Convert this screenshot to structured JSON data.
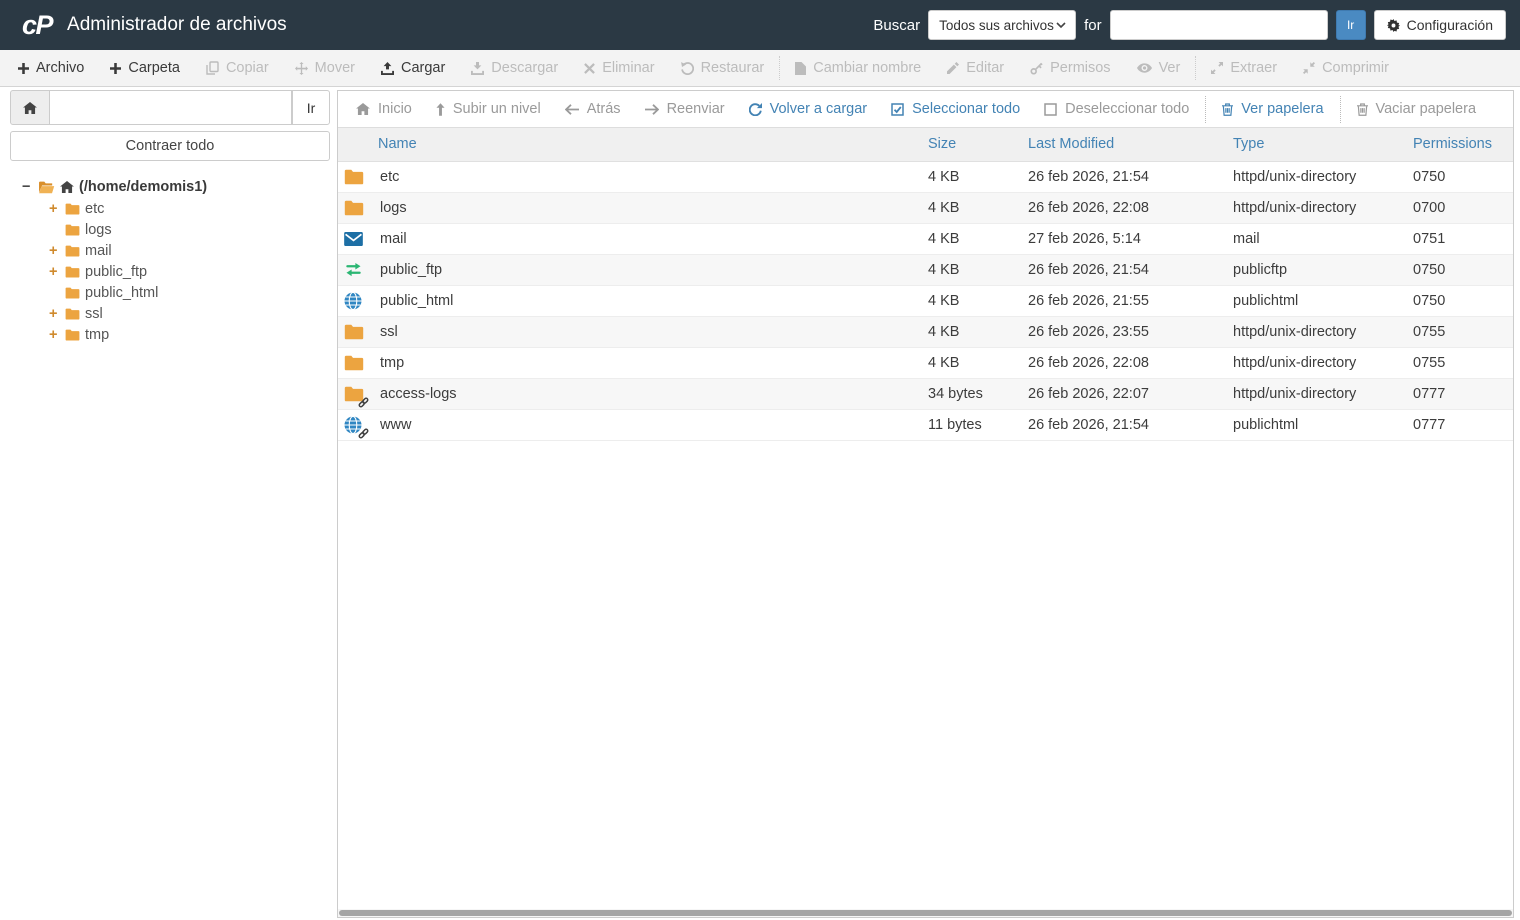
{
  "header": {
    "logo": "cP",
    "title": "Administrador de archivos",
    "search_label": "Buscar",
    "search_scope": "Todos sus archivos",
    "for_label": "for",
    "search_value": "",
    "go_label": "Ir",
    "settings_label": "Configuración"
  },
  "colors": {
    "header_bg": "#2b3944",
    "accent_blue": "#4383b4",
    "button_blue": "#4a8ac2",
    "folder_orange": "#eca440",
    "mail_blue": "#1d6fa5",
    "transfer_green": "#2bb673",
    "globe_blue": "#2f86c2"
  },
  "toolbar": {
    "items": [
      {
        "label": "Archivo",
        "icon": "plus",
        "enabled": true
      },
      {
        "label": "Carpeta",
        "icon": "plus",
        "enabled": true
      },
      {
        "label": "Copiar",
        "icon": "copy",
        "enabled": false
      },
      {
        "label": "Mover",
        "icon": "move",
        "enabled": false
      },
      {
        "label": "Cargar",
        "icon": "upload",
        "enabled": true
      },
      {
        "label": "Descargar",
        "icon": "download",
        "enabled": false
      },
      {
        "label": "Eliminar",
        "icon": "delete",
        "enabled": false
      },
      {
        "label": "Restaurar",
        "icon": "restore",
        "enabled": false
      },
      {
        "label": "Cambiar nombre",
        "icon": "file",
        "enabled": false,
        "sep": true
      },
      {
        "label": "Editar",
        "icon": "edit",
        "enabled": false
      },
      {
        "label": "Permisos",
        "icon": "key",
        "enabled": false
      },
      {
        "label": "Ver",
        "icon": "eye",
        "enabled": false
      },
      {
        "label": "Extraer",
        "icon": "extract",
        "enabled": false,
        "sep": true
      },
      {
        "label": "Comprimir",
        "icon": "compress",
        "enabled": false
      }
    ]
  },
  "sidebar": {
    "path_value": "",
    "go_label": "Ir",
    "collapse_all": "Contraer todo",
    "tree": {
      "root": "(/home/demomis1)",
      "collapse_glyph": "−",
      "expand_glyph": "+",
      "items": [
        {
          "label": "etc",
          "expandable": true
        },
        {
          "label": "logs",
          "expandable": false
        },
        {
          "label": "mail",
          "expandable": true
        },
        {
          "label": "public_ftp",
          "expandable": true
        },
        {
          "label": "public_html",
          "expandable": false
        },
        {
          "label": "ssl",
          "expandable": true
        },
        {
          "label": "tmp",
          "expandable": true
        }
      ]
    }
  },
  "file_toolbar": {
    "items": [
      {
        "label": "Inicio",
        "icon": "home",
        "state": "muted"
      },
      {
        "label": "Subir un nivel",
        "icon": "uplevel",
        "state": "muted"
      },
      {
        "label": "Atrás",
        "icon": "back",
        "state": "muted"
      },
      {
        "label": "Reenviar",
        "icon": "forward",
        "state": "muted"
      },
      {
        "label": "Volver a cargar",
        "icon": "reload",
        "state": "active"
      },
      {
        "label": "Seleccionar todo",
        "icon": "checkbox-checked",
        "state": "active"
      },
      {
        "label": "Deseleccionar todo",
        "icon": "checkbox-empty",
        "state": "muted"
      },
      {
        "label": "Ver papelera",
        "icon": "trash",
        "state": "active",
        "sep": true
      },
      {
        "label": "Vaciar papelera",
        "icon": "trash",
        "state": "muted",
        "sep": true
      }
    ]
  },
  "table": {
    "headers": [
      "Name",
      "Size",
      "Last Modified",
      "Type",
      "Permissions"
    ],
    "rows": [
      {
        "icon": "folder",
        "link": false,
        "name": "etc",
        "size": "4 KB",
        "modified": "26 feb 2026, 21:54",
        "type": "httpd/unix-directory",
        "perms": "0750"
      },
      {
        "icon": "folder",
        "link": false,
        "name": "logs",
        "size": "4 KB",
        "modified": "26 feb 2026, 22:08",
        "type": "httpd/unix-directory",
        "perms": "0700"
      },
      {
        "icon": "mail",
        "link": false,
        "name": "mail",
        "size": "4 KB",
        "modified": "27 feb 2026, 5:14",
        "type": "mail",
        "perms": "0751"
      },
      {
        "icon": "transfer",
        "link": false,
        "name": "public_ftp",
        "size": "4 KB",
        "modified": "26 feb 2026, 21:54",
        "type": "publicftp",
        "perms": "0750"
      },
      {
        "icon": "globe",
        "link": false,
        "name": "public_html",
        "size": "4 KB",
        "modified": "26 feb 2026, 21:55",
        "type": "publichtml",
        "perms": "0750"
      },
      {
        "icon": "folder",
        "link": false,
        "name": "ssl",
        "size": "4 KB",
        "modified": "26 feb 2026, 23:55",
        "type": "httpd/unix-directory",
        "perms": "0755"
      },
      {
        "icon": "folder",
        "link": false,
        "name": "tmp",
        "size": "4 KB",
        "modified": "26 feb 2026, 22:08",
        "type": "httpd/unix-directory",
        "perms": "0755"
      },
      {
        "icon": "folder",
        "link": true,
        "name": "access-logs",
        "size": "34 bytes",
        "modified": "26 feb 2026, 22:07",
        "type": "httpd/unix-directory",
        "perms": "0777"
      },
      {
        "icon": "globe",
        "link": true,
        "name": "www",
        "size": "11 bytes",
        "modified": "26 feb 2026, 21:54",
        "type": "publichtml",
        "perms": "0777"
      }
    ]
  }
}
